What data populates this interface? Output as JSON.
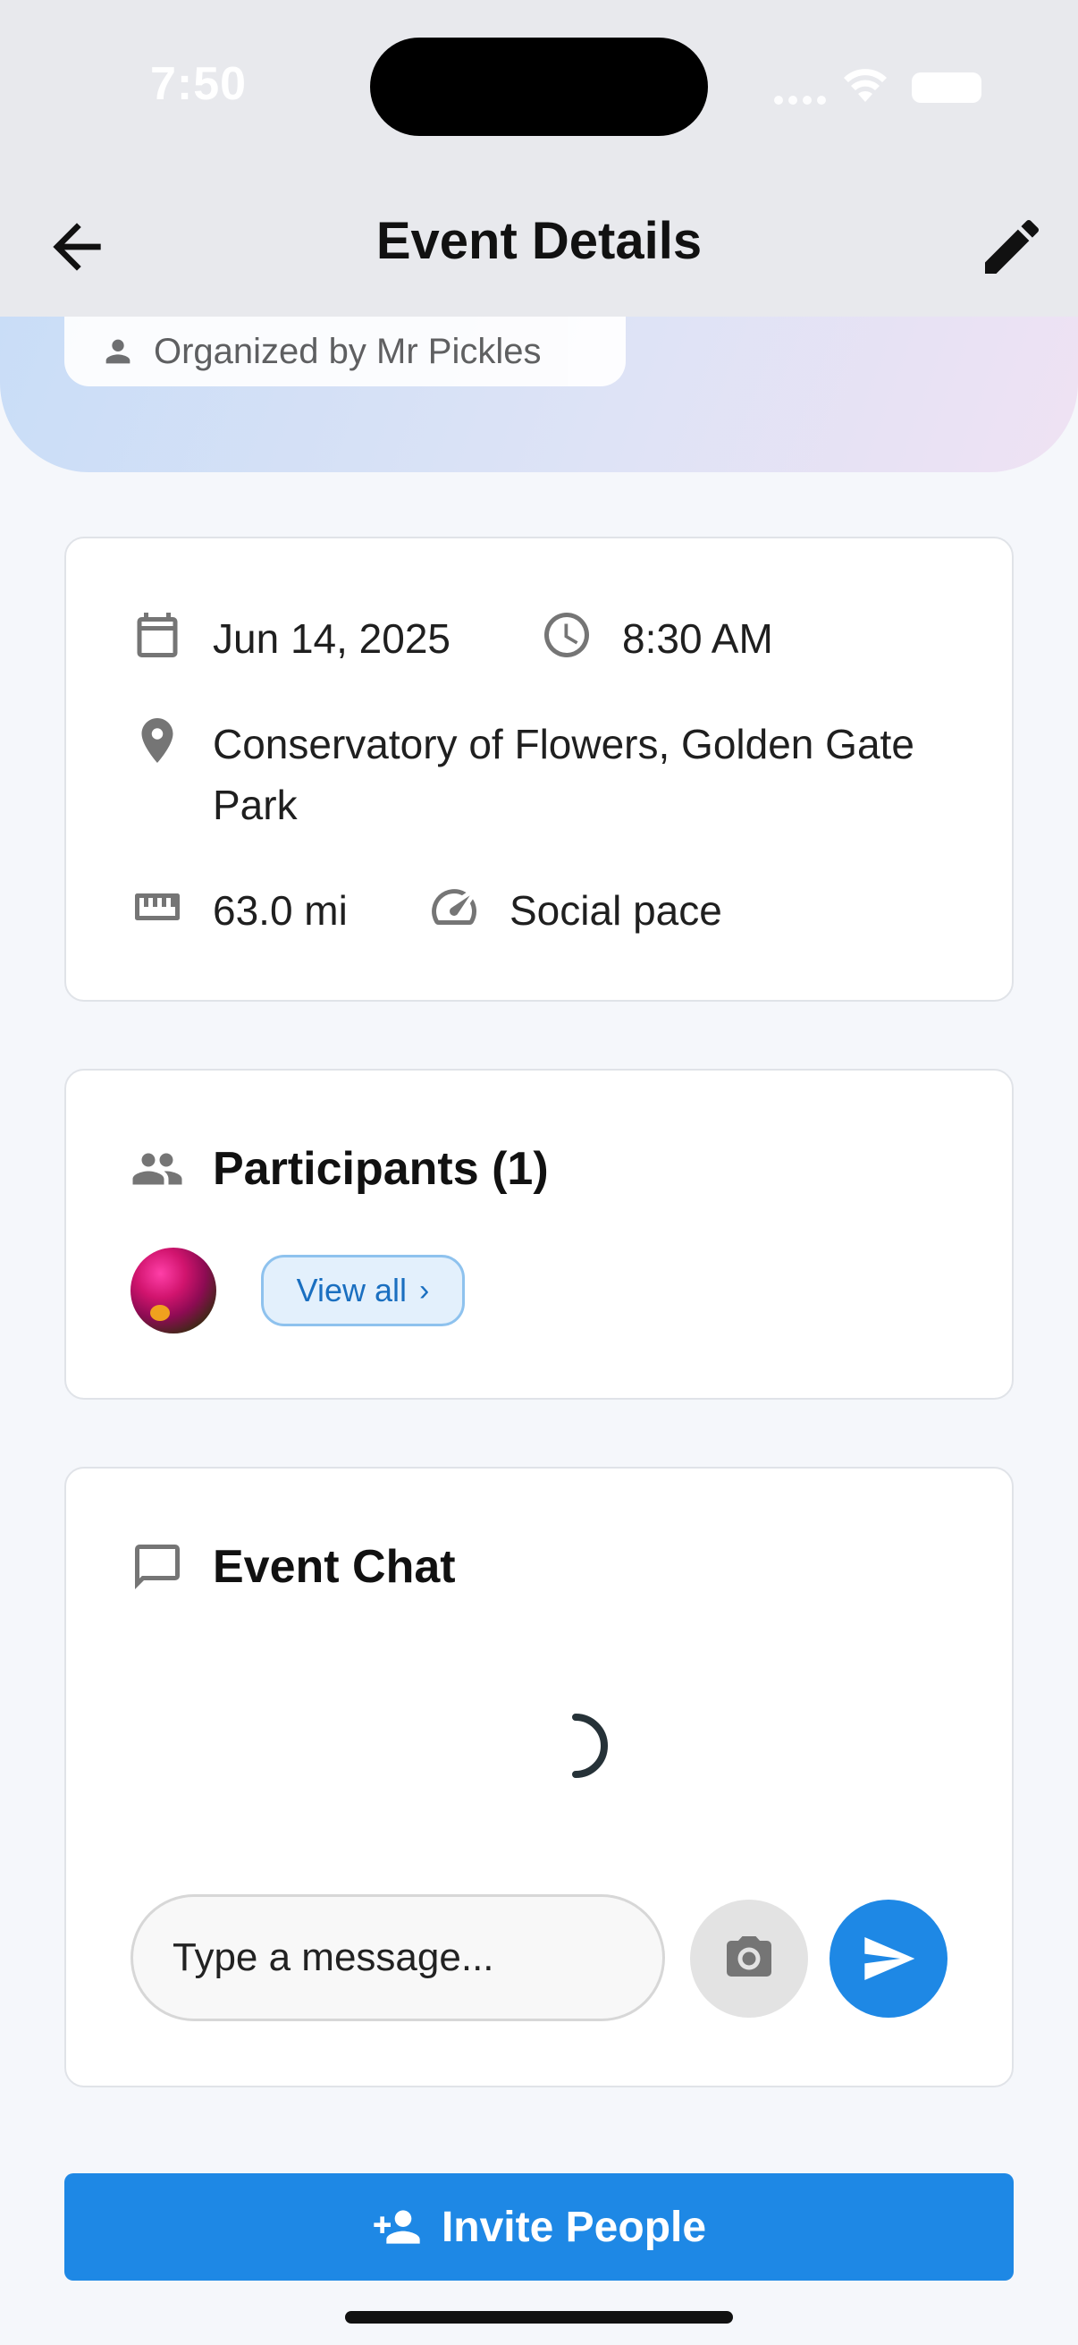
{
  "status_bar": {
    "time": "7:50"
  },
  "header": {
    "title": "Event Details",
    "back_icon": "arrow-left-icon",
    "edit_icon": "pencil-icon"
  },
  "organizer": {
    "label": "Organized by Mr Pickles",
    "icon": "person-icon"
  },
  "details": {
    "date": "Jun 14, 2025",
    "time": "8:30 AM",
    "location": "Conservatory of Flowers, Golden Gate Park",
    "distance": "63.0 mi",
    "pace": "Social pace"
  },
  "participants": {
    "title": "Participants (1)",
    "view_all": "View all"
  },
  "chat": {
    "title": "Event Chat",
    "placeholder": "Type a message..."
  },
  "actions": {
    "invite": "Invite People"
  },
  "colors": {
    "accent": "#1e88e5",
    "header_bg": "#e8e9ed",
    "page_bg": "#f5f7fb"
  }
}
